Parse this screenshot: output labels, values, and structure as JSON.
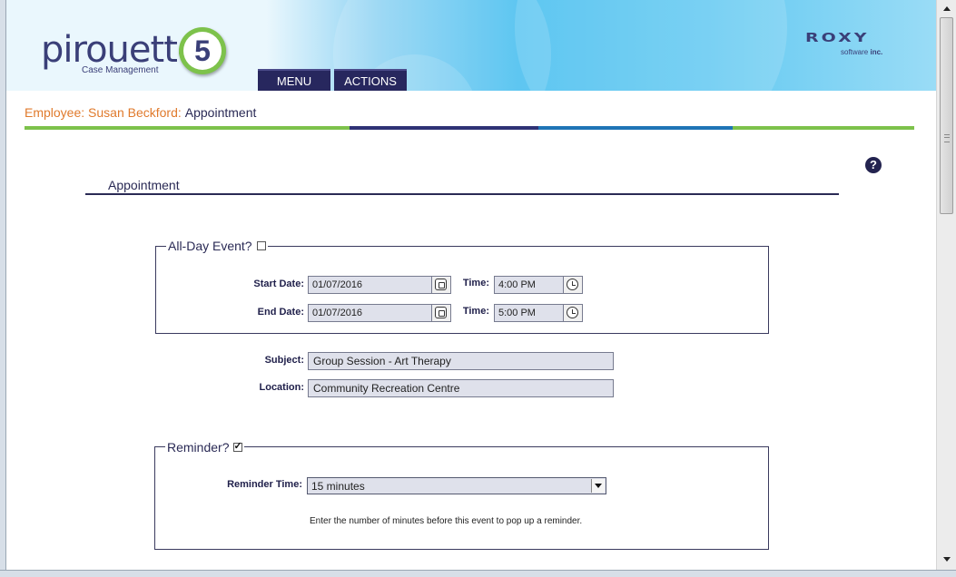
{
  "brand": {
    "name": "pirouette",
    "tm": "™",
    "version": "5",
    "subtitle": "Case Management",
    "company": "ROXY",
    "company_sub_prefix": "software",
    "company_sub_suffix": "inc."
  },
  "nav": {
    "menu_label": "MENU",
    "actions_label": "ACTIONS"
  },
  "breadcrumb": {
    "employee": "Employee: Susan Beckford:",
    "page": "Appointment"
  },
  "colors": {
    "accent_orange": "#e07a2c",
    "navy": "#2a2a55",
    "bar_green": "#7dc24b",
    "bar_navy": "#2f3275",
    "bar_blue": "#1f74b6"
  },
  "help_icon": "question-circle-icon",
  "section": {
    "title": "Appointment"
  },
  "all_day": {
    "label": "All-Day Event?",
    "checked": false
  },
  "start": {
    "date_label": "Start Date:",
    "date_value": "01/07/2016",
    "time_label": "Time:",
    "time_value": "4:00 PM"
  },
  "end": {
    "date_label": "End Date:",
    "date_value": "01/07/2016",
    "time_label": "Time:",
    "time_value": "5:00 PM"
  },
  "subject": {
    "label": "Subject:",
    "value": "Group Session - Art Therapy"
  },
  "location": {
    "label": "Location:",
    "value": "Community Recreation Centre"
  },
  "reminder": {
    "label": "Reminder?",
    "checked": true,
    "time_label": "Reminder Time:",
    "time_value": "15 minutes",
    "hint": "Enter the number of minutes before this event to pop up a reminder."
  }
}
